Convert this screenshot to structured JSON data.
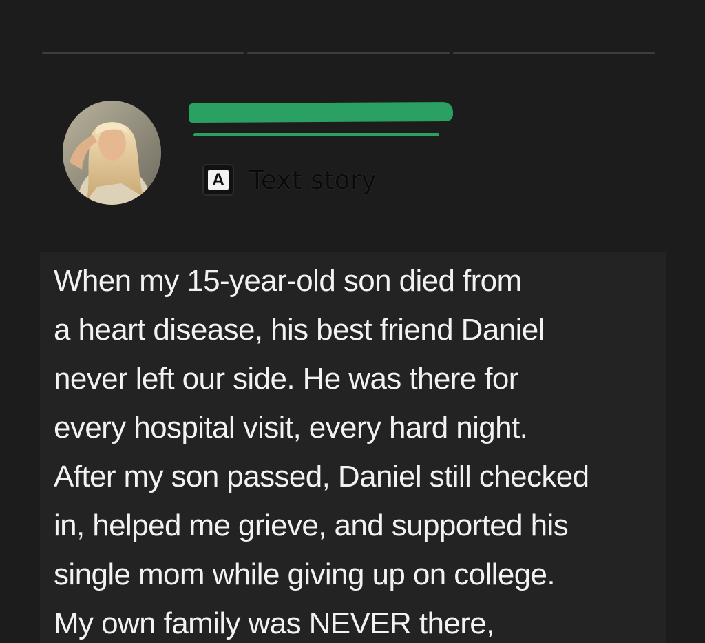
{
  "story": {
    "type_icon_letter": "A",
    "type_label": "Text story",
    "lines": [
      "When my 15-year-old son died from",
      "a heart disease, his best friend Daniel",
      "never left our side. He was there for",
      "every hospital visit, every hard night.",
      "After my son passed, Daniel still checked",
      "in, helped me grieve, and supported his",
      "single mom while giving up on college.",
      "My own family was NEVER there,"
    ]
  },
  "icons": {
    "type_icon": "text-story-icon",
    "avatar": "profile-photo"
  },
  "colors": {
    "background": "#1c1c1c",
    "text": "#f2f2f2",
    "redaction": "#2aa062",
    "progress": "#3d3d3d"
  },
  "progress_segments": 3
}
